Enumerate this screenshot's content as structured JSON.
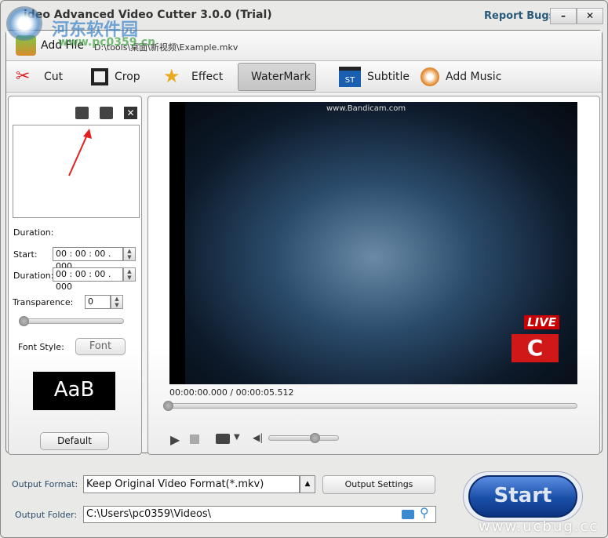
{
  "window": {
    "title": "ideo Advanced Video Cutter 3.0.0 (Trial)",
    "report_bugs": "Report Bugs",
    "minimize": "–",
    "close": "✕"
  },
  "file": {
    "add_file": "Add File",
    "path": "D:\\tools\\桌面\\新视频\\Example.mkv"
  },
  "toolbar": [
    {
      "label": "Cut",
      "icon": "scissors-icon"
    },
    {
      "label": "Crop",
      "icon": "crop-icon"
    },
    {
      "label": "Effect",
      "icon": "stars-icon"
    },
    {
      "label": "WaterMark",
      "icon": "watermark-icon",
      "active": true
    },
    {
      "label": "Subtitle",
      "icon": "clapper-icon"
    },
    {
      "label": "Add Music",
      "icon": "music-disc-icon"
    }
  ],
  "watermark_panel": {
    "duration_heading": "Duration:",
    "start_label": "Start:",
    "start_value": "00 : 00 : 00 . 000",
    "duration_label": "Duration:",
    "duration_value": "00 : 00 : 00 . 000",
    "transparence_label": "Transparence:",
    "transparence_value": "0",
    "transparence_level": 0,
    "font_style_label": "Font Style:",
    "font_button": "Font",
    "preview_text": "AaB",
    "default_button": "Default"
  },
  "player": {
    "video_overlay": "www.Bandicam.com",
    "live_badge": "LIVE",
    "time": "00:00:00.000 / 00:00:05.512",
    "progress": 0,
    "volume": 0.7
  },
  "output": {
    "format_label": "Output Format:",
    "format_value": "Keep Original Video Format(*.mkv)",
    "settings_button": "Output Settings",
    "folder_label": "Output Folder:",
    "folder_value": "C:\\Users\\pc0359\\Videos\\",
    "start_button": "Start"
  },
  "watermarks": {
    "site_cn": "河东软件园",
    "site_url": "www.pc0359.cn",
    "ucbug": "www.ucbug.cc"
  },
  "colors": {
    "accent": "#1a4fa8",
    "arrow": "#e02020"
  }
}
